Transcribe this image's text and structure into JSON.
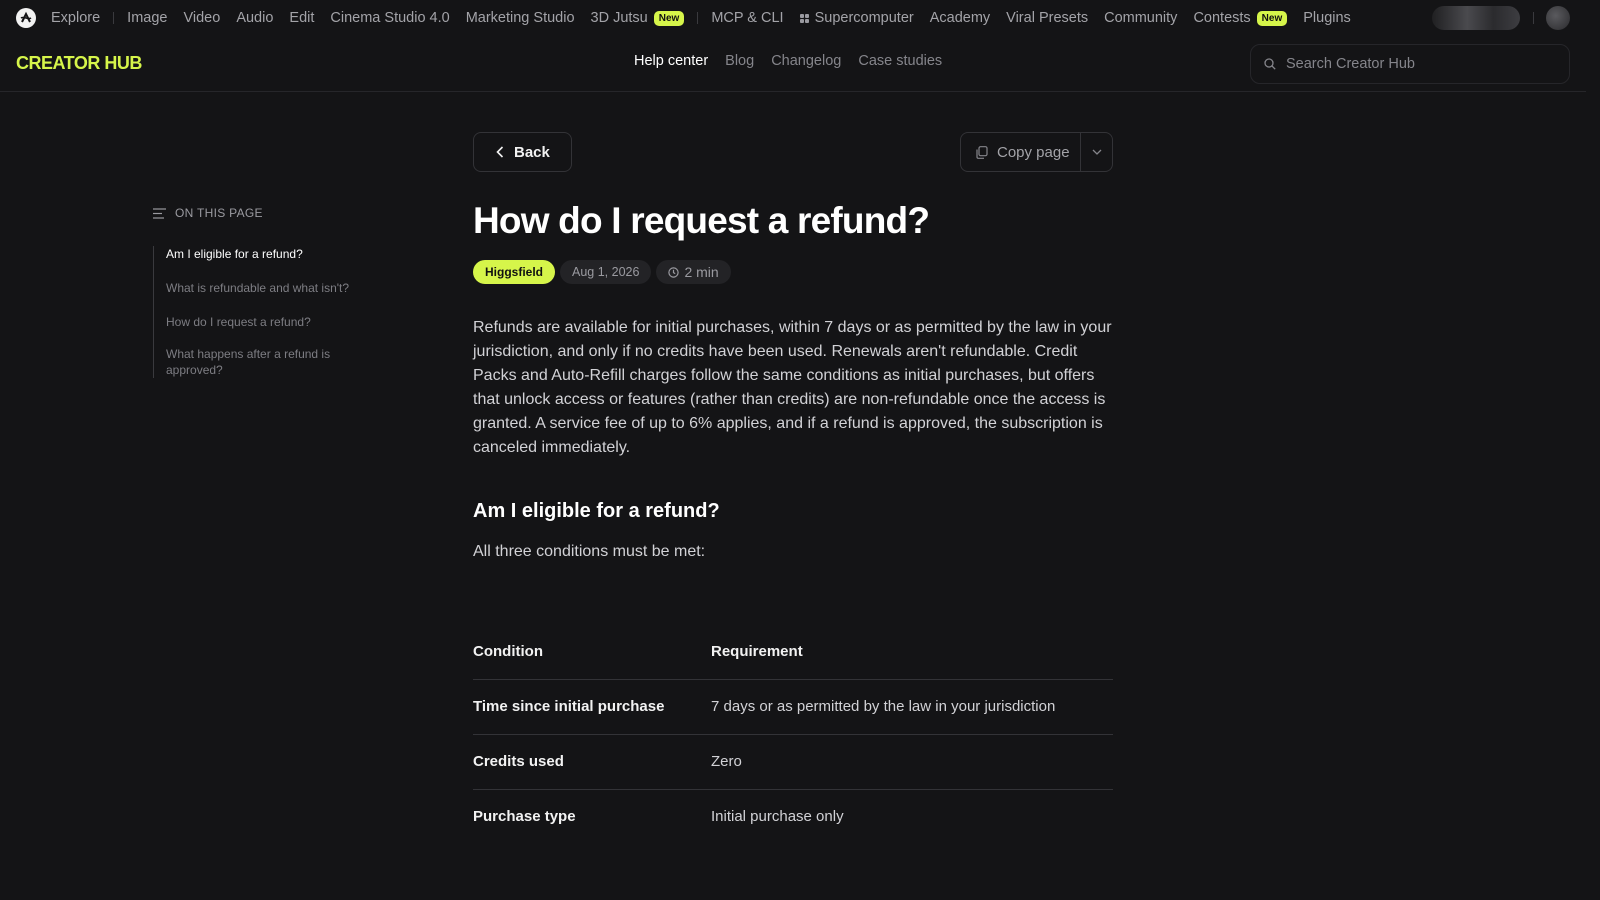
{
  "topnav": {
    "items": [
      {
        "label": "Explore"
      },
      {
        "label": "Image"
      },
      {
        "label": "Video"
      },
      {
        "label": "Audio"
      },
      {
        "label": "Edit"
      },
      {
        "label": "Cinema Studio 4.0"
      },
      {
        "label": "Marketing Studio"
      },
      {
        "label": "3D Jutsu",
        "badge": "New"
      },
      {
        "label": "MCP & CLI"
      },
      {
        "label": "Supercomputer"
      },
      {
        "label": "Academy"
      },
      {
        "label": "Viral Presets"
      },
      {
        "label": "Community"
      },
      {
        "label": "Contests",
        "badge": "New"
      },
      {
        "label": "Plugins"
      }
    ]
  },
  "header": {
    "brand": "CREATOR HUB",
    "tabs": [
      "Help center",
      "Blog",
      "Changelog",
      "Case studies"
    ],
    "active_tab": "Help center",
    "search_placeholder": "Search Creator Hub"
  },
  "toc": {
    "heading": "ON THIS PAGE",
    "items": [
      "Am I eligible for a refund?",
      "What is refundable and what isn't?",
      "How do I request a refund?",
      "What happens after a refund is approved?"
    ]
  },
  "article": {
    "back_label": "Back",
    "copy_label": "Copy page",
    "title": "How do I request a refund?",
    "tag": "Higgsfield",
    "date": "Aug 1, 2026",
    "read_time": "2 min",
    "intro": "Refunds are available for initial purchases, within 7 days or as permitted by the law in your jurisdiction, and only if no credits have been used. Renewals aren't refundable. Credit Packs and Auto-Refill charges follow the same conditions as initial purchases, but offers that unlock access or features (rather than credits) are non-refundable once the access is granted. A service fee of up to 6% applies, and if a refund is approved, the subscription is canceled immediately.",
    "section_title": "Am I eligible for a refund?",
    "section_lead": "All three conditions must be met:",
    "table": {
      "headers": [
        "Condition",
        "Requirement"
      ],
      "rows": [
        [
          "Time since initial purchase",
          "7 days or as permitted by the law in your jurisdiction"
        ],
        [
          "Credits used",
          "Zero"
        ],
        [
          "Purchase type",
          "Initial purchase only"
        ]
      ]
    }
  },
  "colors": {
    "background": "#141416",
    "accent": "#d6f54a",
    "text": "#e6e6e6",
    "muted": "#85858b"
  }
}
